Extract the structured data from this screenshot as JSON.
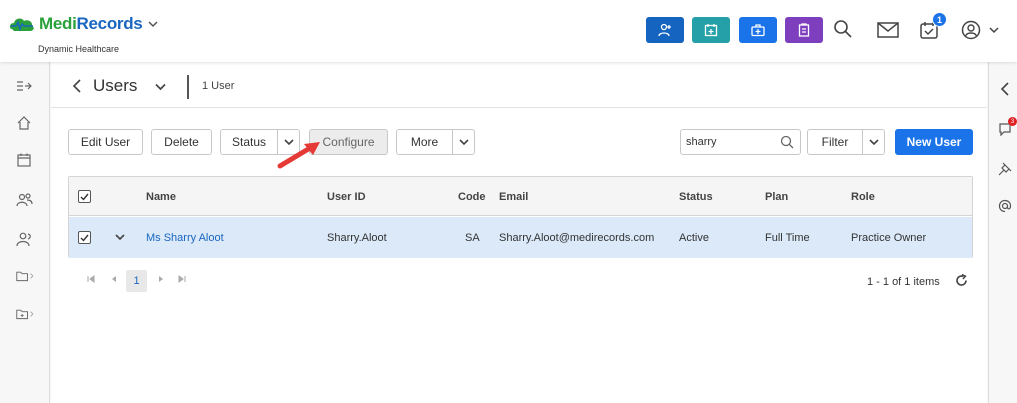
{
  "header": {
    "logo_part1": "Medi",
    "logo_part2": "Records",
    "logo_subtitle": "Dynamic Healthcare",
    "quick_actions": [
      {
        "icon": "add-patient-icon",
        "color": "#1565c0"
      },
      {
        "icon": "calendar-plus-icon",
        "color": "#26a0a8"
      },
      {
        "icon": "medical-kit-icon",
        "color": "#1a73e8"
      },
      {
        "icon": "clipboard-icon",
        "color": "#7e3fbf"
      }
    ],
    "tasks_badge": "1",
    "icons": [
      "search-icon",
      "mail-icon",
      "tasks-icon",
      "user-account-icon"
    ]
  },
  "left_nav": [
    "expand-menu-icon",
    "home-icon",
    "calendar-icon",
    "patients-icon",
    "users-icon",
    "folder-icon",
    "folder-plus-icon"
  ],
  "right_nav": {
    "icons": [
      "collapse-icon",
      "chat-icon",
      "pin-icon",
      "at-icon"
    ],
    "chat_badge": "3"
  },
  "page": {
    "title": "Users",
    "count_label": "1 User"
  },
  "toolbar": {
    "edit_user": "Edit User",
    "delete": "Delete",
    "status": "Status",
    "configure": "Configure",
    "more": "More",
    "search_value": "sharry",
    "filter": "Filter",
    "new_user": "New User"
  },
  "table": {
    "columns": [
      "Name",
      "User ID",
      "Code",
      "Email",
      "Status",
      "Plan",
      "Role"
    ],
    "rows": [
      {
        "name": "Ms Sharry Aloot",
        "user_id": "Sharry.Aloot",
        "code": "SA",
        "email": "Sharry.Aloot@medirecords.com",
        "status": "Active",
        "plan": "Full Time",
        "role": "Practice Owner"
      }
    ]
  },
  "pager": {
    "current_page": "1",
    "info": "1 - 1 of 1 items"
  },
  "colors": {
    "primary": "#1a73e8",
    "selected_row": "#dbe9f8",
    "annotation_arrow": "#e53935"
  }
}
